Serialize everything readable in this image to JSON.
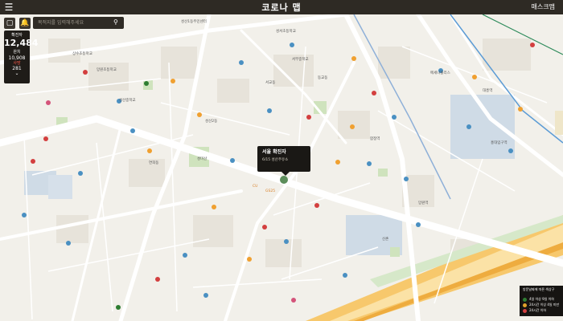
{
  "header": {
    "title": "코로나 맵",
    "right_label": "매스크맵",
    "menu_icon": "hamburger-icon"
  },
  "controls": {
    "search_placeholder": "목적지를 입력해주세요",
    "left_icon": "square-icon",
    "bell_icon": "bell-icon"
  },
  "stats": {
    "confirmed_label": "확진자",
    "confirmed_value": "12,484",
    "recovered_label": "완치",
    "recovered_value": "10,908",
    "deaths_label": "사망",
    "deaths_value": "281"
  },
  "popup": {
    "title": "서울 확진자",
    "detail": "6/15 성산주유소"
  },
  "legend": {
    "title": "방문날짜에 따른 색상구",
    "items": [
      {
        "label": "4일 이상 9일 이하",
        "color": "#2e7d32"
      },
      {
        "label": "24시간 이상 4일 미만",
        "color": "#e0a12a"
      },
      {
        "label": "24시간 이하",
        "color": "#d33f3f"
      }
    ]
  },
  "map_labels": [
    "성산1동주민센터",
    "성서초등학교",
    "상수초등학교",
    "망원초등학교",
    "서부중학교",
    "동교동",
    "성미산",
    "망원역",
    "대흥역",
    "합정역",
    "홍대입구역",
    "성산중학교",
    "성산2동",
    "서교동",
    "신촌",
    "연희동",
    "메세나폴리스",
    "GS25",
    "CU"
  ]
}
